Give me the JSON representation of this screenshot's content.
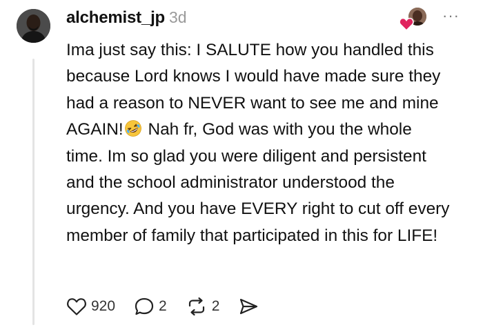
{
  "comment": {
    "username": "alchemist_jp",
    "time": "3d",
    "text_part1": "Ima just say this: I SALUTE how you handled this because Lord knows I would have made sure they had a reason to NEVER want to see me and mine AGAIN!",
    "text_part2": " Nah fr, God was with you the whole time. Im so glad you were diligent and persistent and the school administrator understood the urgency. And you have EVERY right to cut off every member of family that participated in this for LIFE!",
    "emoji": "rolling-on-the-floor-laughing"
  },
  "actions": {
    "likes": "920",
    "replies": "2",
    "reposts": "2"
  },
  "menu": {
    "more_label": "···"
  },
  "colors": {
    "text": "#111111",
    "muted": "#9a9a9a",
    "thread_line": "#e4e4e4",
    "heart": "#e0245e",
    "emoji_yellow": "#f7c53b"
  }
}
